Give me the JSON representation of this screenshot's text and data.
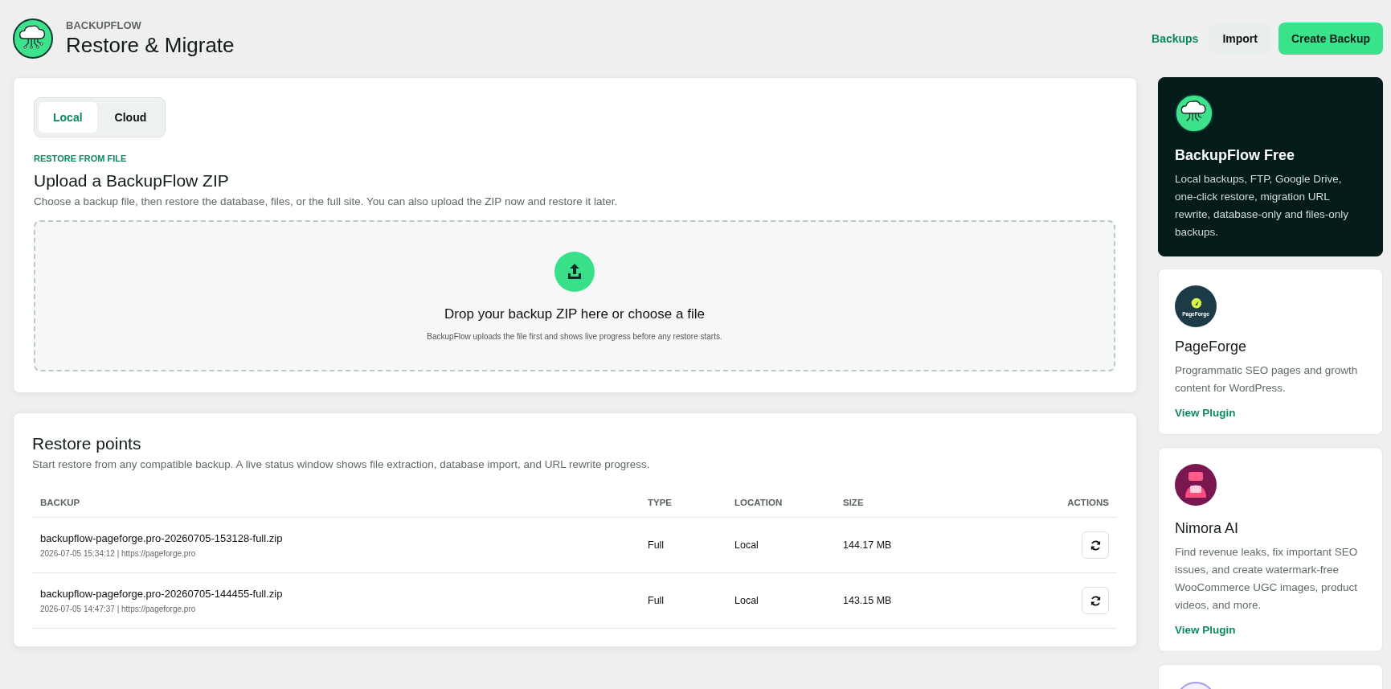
{
  "header": {
    "eyebrow": "BACKUPFLOW",
    "title": "Restore & Migrate",
    "nav": [
      {
        "label": "Backups",
        "kind": "link"
      },
      {
        "label": "Import",
        "kind": "secondary"
      },
      {
        "label": "Create Backup",
        "kind": "primary"
      }
    ]
  },
  "upload": {
    "tabs": [
      {
        "label": "Local",
        "selected": true
      },
      {
        "label": "Cloud",
        "selected": false
      }
    ],
    "eyebrow": "RESTORE FROM FILE",
    "title": "Upload a BackupFlow ZIP",
    "description": "Choose a backup file, then restore the database, files, or the full site. You can also upload the ZIP now and restore it later.",
    "dropzone": {
      "title": "Drop your backup ZIP here or choose a file",
      "hint": "BackupFlow uploads the file first and shows live progress before any restore starts."
    }
  },
  "restore_points": {
    "title": "Restore points",
    "description": "Start restore from any compatible backup. A live status window shows file extraction, database import, and URL rewrite progress.",
    "columns": [
      "BACKUP",
      "TYPE",
      "LOCATION",
      "SIZE",
      "ACTIONS"
    ],
    "rows": [
      {
        "name": "backupflow-pageforge.pro-20260705-153128-full.zip",
        "meta": "2026-07-05 15:34:12 | https://pageforge.pro",
        "type": "Full",
        "location": "Local",
        "size": "144.17 MB"
      },
      {
        "name": "backupflow-pageforge.pro-20260705-144455-full.zip",
        "meta": "2026-07-05 14:47:37 | https://pageforge.pro",
        "type": "Full",
        "location": "Local",
        "size": "143.15 MB"
      }
    ]
  },
  "sidebar": [
    {
      "kind": "feature",
      "title": "BackupFlow Free",
      "description": "Local backups, FTP, Google Drive, one-click restore, migration URL rewrite, database-only and files-only backups."
    },
    {
      "kind": "plugin",
      "logo": {
        "kind": "rocket",
        "text": "PageForge"
      },
      "title": "PageForge",
      "description": "Programmatic SEO pages and growth content for WordPress.",
      "link": "View Plugin"
    },
    {
      "kind": "plugin",
      "logo": {
        "kind": "robot"
      },
      "title": "Nimora AI",
      "description": "Find revenue leaks, fix important SEO issues, and create watermark-free WooCommerce UGC images, product videos, and more.",
      "link": "View Plugin"
    },
    {
      "kind": "partial",
      "logo": {
        "kind": "ring"
      }
    }
  ]
}
